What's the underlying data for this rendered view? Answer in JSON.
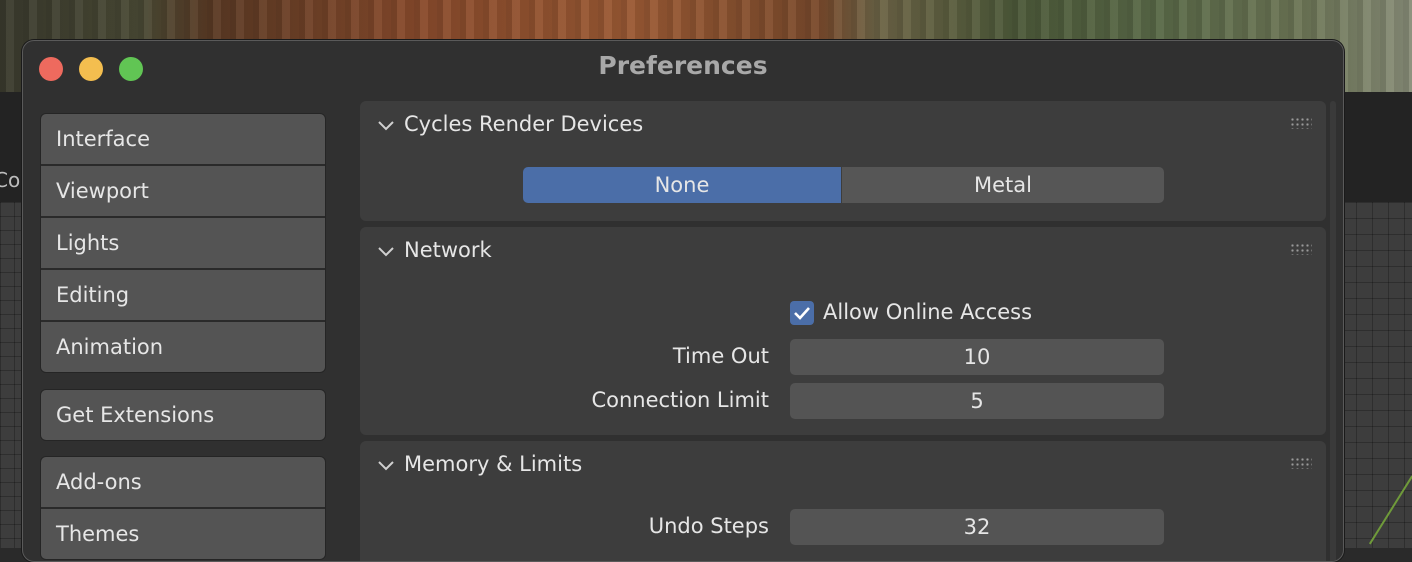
{
  "window": {
    "title": "Preferences"
  },
  "background": {
    "left_text": "Co"
  },
  "sidebar": {
    "groups": [
      {
        "items": [
          {
            "label": "Interface"
          },
          {
            "label": "Viewport"
          },
          {
            "label": "Lights"
          },
          {
            "label": "Editing"
          },
          {
            "label": "Animation"
          }
        ]
      },
      {
        "items": [
          {
            "label": "Get Extensions"
          }
        ]
      },
      {
        "items": [
          {
            "label": "Add-ons"
          },
          {
            "label": "Themes"
          }
        ]
      }
    ]
  },
  "panels": {
    "cycles": {
      "title": "Cycles Render Devices",
      "options": [
        {
          "label": "None",
          "selected": true
        },
        {
          "label": "Metal",
          "selected": false
        }
      ]
    },
    "network": {
      "title": "Network",
      "allow_online_access": {
        "label": "Allow Online Access",
        "checked": true
      },
      "time_out": {
        "label": "Time Out",
        "value": "10"
      },
      "connection_limit": {
        "label": "Connection Limit",
        "value": "5"
      }
    },
    "memory": {
      "title": "Memory & Limits",
      "undo_steps": {
        "label": "Undo Steps",
        "value": "32"
      }
    }
  },
  "colors": {
    "accent": "#4b6ea8",
    "panel_bg": "#3d3d3d",
    "window_bg": "#303030",
    "button_bg": "#545454",
    "close": "#ee6a5e",
    "minimize": "#f4be4f",
    "maximize": "#61c554"
  }
}
